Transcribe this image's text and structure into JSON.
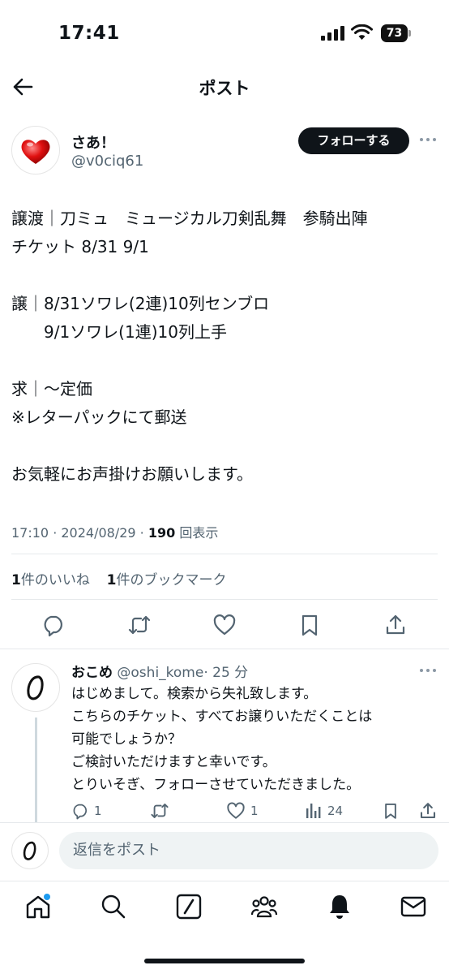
{
  "status_bar": {
    "time": "17:41",
    "battery": "73"
  },
  "header": {
    "title": "ポスト"
  },
  "author": {
    "name": "さあ！",
    "handle": "@v0ciq61",
    "follow_label": "フォローする"
  },
  "post": {
    "lines": [
      "譲渡｜刀ミュ　ミュージカル刀剣乱舞　参騎出陣",
      "チケット 8/31 9/1",
      "",
      "譲｜8/31ソワレ(2連)10列センブロ",
      "　　9/1ソワレ(1連)10列上手",
      "",
      "求｜〜定価",
      "※レターパックにて郵送",
      "",
      "お気軽にお声掛けお願いします。"
    ],
    "time": "17:10 · 2024/08/29 · ",
    "views": "190",
    "views_label": " 回表示"
  },
  "stats": {
    "likes_count": "1",
    "likes_label": "件のいいね",
    "bookmarks_count": "1",
    "bookmarks_label": "件のブックマーク"
  },
  "reply": {
    "name": "おこめ",
    "handle": "@oshi_kome",
    "time": "· 25 分",
    "lines": [
      "はじめまして。検索から失礼致します。",
      "こちらのチケット、すべてお譲りいただくことは",
      "可能でしょうか？",
      "ご検討いただけますと幸いです。",
      "とりいそぎ、フォローさせていただきました。"
    ],
    "reply_count": "1",
    "like_count": "1",
    "view_count": "24"
  },
  "composer": {
    "placeholder": "返信をポスト"
  },
  "colors": {
    "text": "#0f1419",
    "muted": "#536471",
    "accent": "#1d9bf0",
    "divider": "#e6e9ec",
    "input_bg": "#eff3f4"
  },
  "icons": [
    "back-arrow-icon",
    "more-icon",
    "reply-icon",
    "retweet-icon",
    "like-icon",
    "bookmark-icon",
    "share-icon",
    "views-icon",
    "home-icon",
    "search-icon",
    "grok-icon",
    "communities-icon",
    "notifications-icon",
    "messages-icon"
  ]
}
